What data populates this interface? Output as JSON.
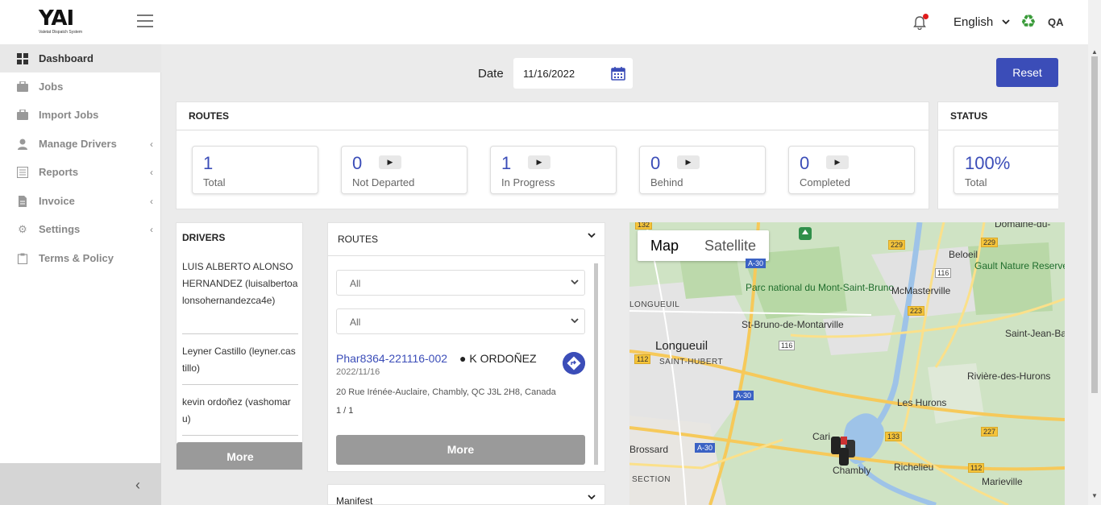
{
  "app": {
    "logo_text": "YAI",
    "logo_sub": "Valetat Dispatch System",
    "language": "English",
    "user": "QA"
  },
  "sidebar": {
    "items": [
      {
        "label": "Dashboard",
        "icon": "dashboard-grid-icon"
      },
      {
        "label": "Jobs",
        "icon": "briefcase-icon"
      },
      {
        "label": "Import Jobs",
        "icon": "briefcase-icon"
      },
      {
        "label": "Manage Drivers",
        "icon": "user-icon"
      },
      {
        "label": "Reports",
        "icon": "report-icon"
      },
      {
        "label": "Invoice",
        "icon": "document-icon"
      },
      {
        "label": "Settings",
        "icon": "gear-icon"
      },
      {
        "label": "Terms & Policy",
        "icon": "clipboard-icon"
      }
    ]
  },
  "filters": {
    "date_label": "Date",
    "date_value": "11/16/2022",
    "reset_label": "Reset"
  },
  "routes_summary": {
    "title": "ROUTES",
    "cards": [
      {
        "value": "1",
        "label": "Total"
      },
      {
        "value": "0",
        "label": "Not Departed"
      },
      {
        "value": "1",
        "label": "In Progress"
      },
      {
        "value": "0",
        "label": "Behind"
      },
      {
        "value": "0",
        "label": "Completed"
      }
    ]
  },
  "status_summary": {
    "title": "STATUS",
    "value": "100%",
    "label": "Total"
  },
  "drivers": {
    "title": "DRIVERS",
    "items": [
      "LUIS ALBERTO ALONSO HERNANDEZ (luisalbertoalonsohernandezca4e)",
      "Leyner Castillo (leyner.castillo)",
      "kevin ordoñez (vashomaru)"
    ],
    "more_label": "More"
  },
  "routes_list": {
    "title": "ROUTES",
    "filter1": "All",
    "filter2": "All",
    "route": {
      "id": "Phar8364-221116-002",
      "driver": "● K ORDOÑEZ",
      "date": "2022/11/16",
      "address": "20 Rue Irénée-Auclaire, Chambly, QC J3L 2H8, Canada",
      "progress": "1 / 1"
    },
    "more_label": "More"
  },
  "manifest": {
    "title": "Manifest"
  },
  "map": {
    "tab_map": "Map",
    "tab_satellite": "Satellite",
    "labels": {
      "longueuil_caps": "LONGUEUIL",
      "parc": "Parc national du Mont-Saint-Bruno",
      "st_bruno": "St-Bruno-de-Montarville",
      "mcmasterville": "McMasterville",
      "beloeil": "Beloeil",
      "gault": "Gault Nature Reserve of McGill University",
      "saint_jean": "Saint-Jean-Ba",
      "longueuil": "Longueuil",
      "saint_hubert": "SAINT-HUBERT",
      "riviere": "Rivière-des-Hurons",
      "les_hurons": "Les Hurons",
      "domaine": "Domaine-du-",
      "brossard": "Brossard",
      "carignan": "Cari",
      "chambly": "Chambly",
      "richelieu": "Richelieu",
      "marieville": "Marieville",
      "section": "SECTION"
    },
    "shields": {
      "a30_top": "A-30",
      "r229a": "229",
      "r229b": "229",
      "r116": "116",
      "r116b": "116",
      "r223": "223",
      "r112": "112",
      "a30_mid": "A-30",
      "a30_low": "A-30",
      "r133": "133",
      "r227": "227",
      "r112b": "112",
      "r132": "132"
    }
  }
}
